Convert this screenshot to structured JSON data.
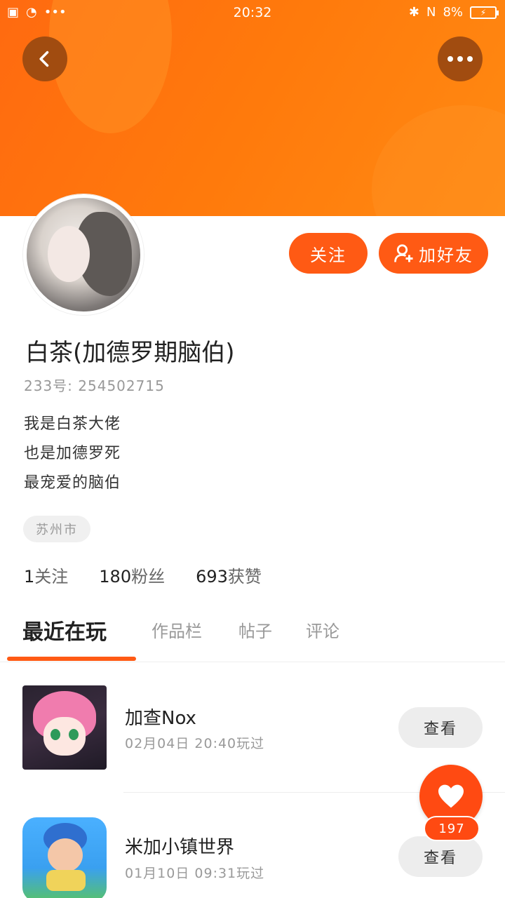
{
  "status_bar": {
    "time": "20:32",
    "battery": "8%",
    "signal_label": "N"
  },
  "header": {
    "back_icon": "chevron-left-icon",
    "more_icon": "more-horizontal-icon"
  },
  "profile": {
    "name": "白茶(加德罗期脑伯)",
    "uid_label": "233号:",
    "uid": "254502715",
    "bio": [
      "我是白茶大佬",
      "也是加德罗死",
      "最宠爱的脑伯"
    ],
    "location": "苏州市",
    "follow_label": "关注",
    "add_friend_label": "加好友"
  },
  "stats": [
    {
      "num": "1",
      "label": "关注"
    },
    {
      "num": "180",
      "label": "粉丝"
    },
    {
      "num": "693",
      "label": "获赞"
    }
  ],
  "tabs": [
    {
      "label": "最近在玩",
      "active": true
    },
    {
      "label": "作品栏",
      "active": false
    },
    {
      "label": "帖子",
      "active": false
    },
    {
      "label": "评论",
      "active": false
    }
  ],
  "games": [
    {
      "title": "加查Nox",
      "time": "02月04日 20:40玩过",
      "action": "查看"
    },
    {
      "title": "米加小镇世界",
      "time": "01月10日 09:31玩过",
      "action": "查看"
    }
  ],
  "like": {
    "count": "197"
  },
  "colors": {
    "accent": "#ff5a14",
    "header": "#ff7a0c"
  }
}
